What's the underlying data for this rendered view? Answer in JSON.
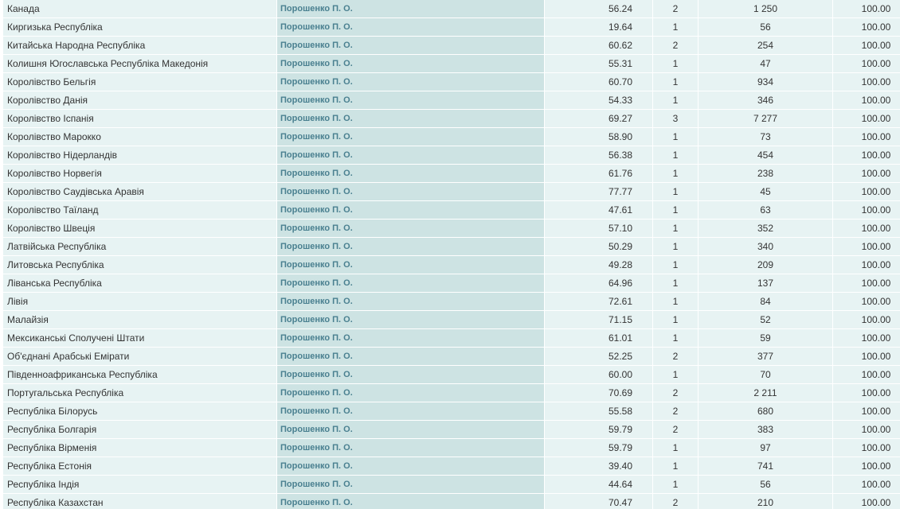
{
  "rows": [
    {
      "country": "Канада",
      "candidate": "Порошенко П. О.",
      "percent": "56.24",
      "pp": "2",
      "votes": "1 250",
      "processed": "100.00"
    },
    {
      "country": "Киргизька Республіка",
      "candidate": "Порошенко П. О.",
      "percent": "19.64",
      "pp": "1",
      "votes": "56",
      "processed": "100.00"
    },
    {
      "country": "Китайська Народна Республіка",
      "candidate": "Порошенко П. О.",
      "percent": "60.62",
      "pp": "2",
      "votes": "254",
      "processed": "100.00"
    },
    {
      "country": "Колишня Югославська Республіка Македонія",
      "candidate": "Порошенко П. О.",
      "percent": "55.31",
      "pp": "1",
      "votes": "47",
      "processed": "100.00"
    },
    {
      "country": "Королівство Бельгія",
      "candidate": "Порошенко П. О.",
      "percent": "60.70",
      "pp": "1",
      "votes": "934",
      "processed": "100.00"
    },
    {
      "country": "Королівство Данія",
      "candidate": "Порошенко П. О.",
      "percent": "54.33",
      "pp": "1",
      "votes": "346",
      "processed": "100.00"
    },
    {
      "country": "Королівство Іспанія",
      "candidate": "Порошенко П. О.",
      "percent": "69.27",
      "pp": "3",
      "votes": "7 277",
      "processed": "100.00"
    },
    {
      "country": "Королівство Марокко",
      "candidate": "Порошенко П. О.",
      "percent": "58.90",
      "pp": "1",
      "votes": "73",
      "processed": "100.00"
    },
    {
      "country": "Королівство Нідерландів",
      "candidate": "Порошенко П. О.",
      "percent": "56.38",
      "pp": "1",
      "votes": "454",
      "processed": "100.00"
    },
    {
      "country": "Королівство Норвегія",
      "candidate": "Порошенко П. О.",
      "percent": "61.76",
      "pp": "1",
      "votes": "238",
      "processed": "100.00"
    },
    {
      "country": "Королівство Саудівська Аравія",
      "candidate": "Порошенко П. О.",
      "percent": "77.77",
      "pp": "1",
      "votes": "45",
      "processed": "100.00"
    },
    {
      "country": "Королівство Таїланд",
      "candidate": "Порошенко П. О.",
      "percent": "47.61",
      "pp": "1",
      "votes": "63",
      "processed": "100.00"
    },
    {
      "country": "Королівство Швеція",
      "candidate": "Порошенко П. О.",
      "percent": "57.10",
      "pp": "1",
      "votes": "352",
      "processed": "100.00"
    },
    {
      "country": "Латвійська Республіка",
      "candidate": "Порошенко П. О.",
      "percent": "50.29",
      "pp": "1",
      "votes": "340",
      "processed": "100.00"
    },
    {
      "country": "Литовська Республіка",
      "candidate": "Порошенко П. О.",
      "percent": "49.28",
      "pp": "1",
      "votes": "209",
      "processed": "100.00"
    },
    {
      "country": "Ліванська Республіка",
      "candidate": "Порошенко П. О.",
      "percent": "64.96",
      "pp": "1",
      "votes": "137",
      "processed": "100.00"
    },
    {
      "country": "Лівія",
      "candidate": "Порошенко П. О.",
      "percent": "72.61",
      "pp": "1",
      "votes": "84",
      "processed": "100.00"
    },
    {
      "country": "Малайзія",
      "candidate": "Порошенко П. О.",
      "percent": "71.15",
      "pp": "1",
      "votes": "52",
      "processed": "100.00"
    },
    {
      "country": "Мексиканські Сполучені Штати",
      "candidate": "Порошенко П. О.",
      "percent": "61.01",
      "pp": "1",
      "votes": "59",
      "processed": "100.00"
    },
    {
      "country": "Об'єднані Арабські Емірати",
      "candidate": "Порошенко П. О.",
      "percent": "52.25",
      "pp": "2",
      "votes": "377",
      "processed": "100.00"
    },
    {
      "country": "Південноафриканська Республіка",
      "candidate": "Порошенко П. О.",
      "percent": "60.00",
      "pp": "1",
      "votes": "70",
      "processed": "100.00"
    },
    {
      "country": "Португальська Республіка",
      "candidate": "Порошенко П. О.",
      "percent": "70.69",
      "pp": "2",
      "votes": "2 211",
      "processed": "100.00"
    },
    {
      "country": "Республіка Білорусь",
      "candidate": "Порошенко П. О.",
      "percent": "55.58",
      "pp": "2",
      "votes": "680",
      "processed": "100.00"
    },
    {
      "country": "Республіка Болгарія",
      "candidate": "Порошенко П. О.",
      "percent": "59.79",
      "pp": "2",
      "votes": "383",
      "processed": "100.00"
    },
    {
      "country": "Республіка Вірменія",
      "candidate": "Порошенко П. О.",
      "percent": "59.79",
      "pp": "1",
      "votes": "97",
      "processed": "100.00"
    },
    {
      "country": "Республіка Естонія",
      "candidate": "Порошенко П. О.",
      "percent": "39.40",
      "pp": "1",
      "votes": "741",
      "processed": "100.00"
    },
    {
      "country": "Республіка Індія",
      "candidate": "Порошенко П. О.",
      "percent": "44.64",
      "pp": "1",
      "votes": "56",
      "processed": "100.00"
    },
    {
      "country": "Республіка Казахстан",
      "candidate": "Порошенко П. О.",
      "percent": "70.47",
      "pp": "2",
      "votes": "210",
      "processed": "100.00"
    }
  ],
  "colors": {
    "row_bg": "#e7f3f3",
    "candidate_bg": "#cde3e3",
    "candidate_text": "#4a8090",
    "text": "#333333",
    "separator": "#ffffff"
  }
}
